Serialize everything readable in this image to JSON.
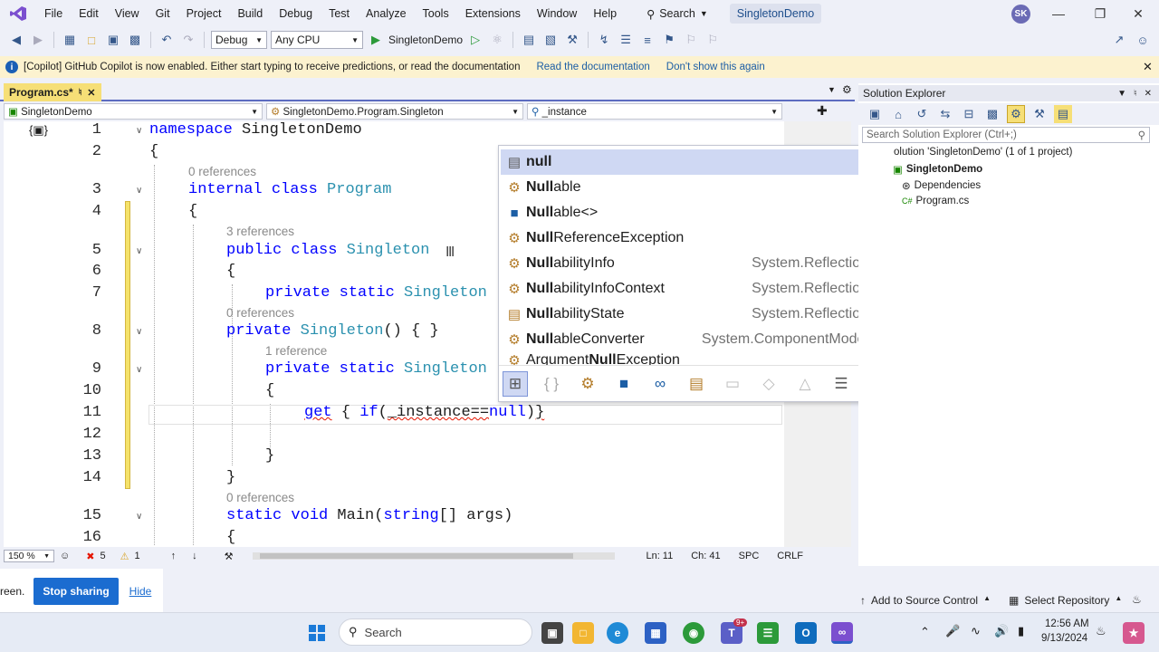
{
  "menubar": {
    "items": [
      "File",
      "Edit",
      "View",
      "Git",
      "Project",
      "Build",
      "Debug",
      "Test",
      "Analyze",
      "Tools",
      "Extensions",
      "Window",
      "Help"
    ],
    "search_label": "Search",
    "solution_title": "SingletonDemo",
    "avatar_initials": "SK"
  },
  "toolbar": {
    "config": "Debug",
    "platform": "Any CPU",
    "run_target": "SingletonDemo"
  },
  "infobar": {
    "message": "[Copilot] GitHub Copilot is now enabled. Either start typing to receive predictions, or read the documentation",
    "link_read": "Read the documentation",
    "link_dismiss": "Don't show this again"
  },
  "editor": {
    "tab_label": "Program.cs*",
    "nav_project": "SingletonDemo",
    "nav_type": "SingletonDemo.Program.Singleton",
    "nav_member": "_instance",
    "lines": [
      {
        "n": "1",
        "code": "namespace SingletonDemo"
      },
      {
        "n": "2",
        "code": "{"
      },
      {
        "n": "3",
        "code": "internal class Program"
      },
      {
        "n": "4",
        "code": "{"
      },
      {
        "n": "5",
        "code": "public class Singleton"
      },
      {
        "n": "6",
        "code": "{"
      },
      {
        "n": "7",
        "code": "private static Singleton"
      },
      {
        "n": "8",
        "code": "private Singleton() { }"
      },
      {
        "n": "9",
        "code": "private static Singleton"
      },
      {
        "n": "10",
        "code": "{"
      },
      {
        "n": "11",
        "code": "get { if(_instance==null)}"
      },
      {
        "n": "12",
        "code": ""
      },
      {
        "n": "13",
        "code": "}"
      },
      {
        "n": "14",
        "code": "}"
      },
      {
        "n": "15",
        "code": "static void Main(string[] args)"
      },
      {
        "n": "16",
        "code": "{"
      }
    ],
    "lens": {
      "program": "0 references",
      "singleton": "3 references",
      "ctor": "0 references",
      "instance_prop": "1 reference",
      "main": "0 references"
    },
    "status": {
      "zoom": "150 %",
      "errors": "5",
      "warnings": "1",
      "ln": "Ln: 11",
      "ch": "Ch: 41",
      "spc": "SPC",
      "crlf": "CRLF"
    }
  },
  "completion": {
    "items": [
      {
        "label": "null",
        "ns": "",
        "icon": "keyword-icon"
      },
      {
        "label": "Nullable",
        "ns": "",
        "icon": "class-icon"
      },
      {
        "label": "Nullable<>",
        "ns": "",
        "icon": "struct-icon"
      },
      {
        "label": "NullReferenceException",
        "ns": "",
        "icon": "class-icon"
      },
      {
        "label": "NullabilityInfo",
        "ns": "System.Reflection",
        "icon": "class-icon"
      },
      {
        "label": "NullabilityInfoContext",
        "ns": "System.Reflection",
        "icon": "class-icon"
      },
      {
        "label": "NullabilityState",
        "ns": "System.Reflection",
        "icon": "enum-icon"
      },
      {
        "label": "NullableConverter",
        "ns": "System.ComponentModel",
        "icon": "class-icon"
      },
      {
        "label": "ArgumentNullException",
        "ns": "",
        "icon": "class-icon"
      }
    ]
  },
  "solution_explorer": {
    "title": "Solution Explorer",
    "search_placeholder": "Search Solution Explorer (Ctrl+;)",
    "solution": "olution 'SingletonDemo' (1 of 1 project)",
    "project": "SingletonDemo",
    "dependencies": "Dependencies",
    "file": "Program.cs",
    "file_prefix": "C#"
  },
  "share": {
    "fragment": "reen.",
    "stop": "Stop sharing",
    "hide": "Hide"
  },
  "bottom_status": {
    "source_control": "Add to Source Control",
    "select_repo": "Select Repository"
  },
  "taskbar": {
    "search": "Search",
    "time": "12:56 AM",
    "date": "9/13/2024",
    "teams_badge": "9+"
  }
}
